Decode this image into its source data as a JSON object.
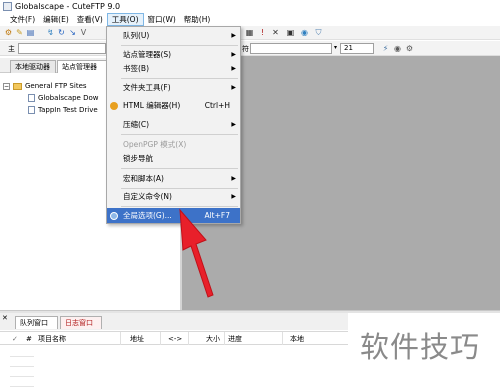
{
  "window": {
    "title": "Globalscape - CuteFTP 9.0"
  },
  "menubar": [
    {
      "label": "文件(F)"
    },
    {
      "label": "编辑(E)"
    },
    {
      "label": "查看(V)"
    },
    {
      "label": "工具(O)"
    },
    {
      "label": "窗口(W)"
    },
    {
      "label": "帮助(H)"
    }
  ],
  "quickconnect": {
    "host_label": "主",
    "password_label": "符",
    "port_value": "21"
  },
  "left_tabs": {
    "local": "本地驱动器",
    "site_manager": "站点管理器"
  },
  "tree": {
    "root": "General FTP Sites",
    "children": [
      "Globalscape Dow",
      "TappIn Test Drive"
    ]
  },
  "tools_menu": {
    "items": [
      {
        "label": "队列(U)",
        "shortcut": "",
        "submenu": true,
        "disabled": false
      },
      {
        "label": "站点管理器(S)",
        "shortcut": "",
        "submenu": true,
        "disabled": false
      },
      {
        "label": "书签(B)",
        "shortcut": "",
        "submenu": true,
        "disabled": false
      },
      {
        "label": "文件夹工具(F)",
        "shortcut": "",
        "submenu": true,
        "disabled": false
      },
      {
        "label": "HTML 编辑器(H)",
        "shortcut": "Ctrl+H",
        "submenu": false,
        "disabled": false
      },
      {
        "label": "压缩(C)",
        "shortcut": "",
        "submenu": true,
        "disabled": false
      },
      {
        "label": "OpenPGP 模式(X)",
        "shortcut": "",
        "submenu": false,
        "disabled": true
      },
      {
        "label": "锁步导航",
        "shortcut": "",
        "submenu": false,
        "disabled": false
      },
      {
        "label": "宏和脚本(A)",
        "shortcut": "",
        "submenu": true,
        "disabled": false
      },
      {
        "label": "自定义命令(N)",
        "shortcut": "",
        "submenu": true,
        "disabled": false
      },
      {
        "label": "全局选项(G)...",
        "shortcut": "Alt+F7",
        "submenu": false,
        "disabled": false
      }
    ]
  },
  "bottom_tabs": {
    "queue": "队列窗口",
    "log": "日志窗口"
  },
  "queue_columns": [
    "#",
    "项目名称",
    "地址",
    "<->",
    "大小",
    "进度",
    "本地"
  ],
  "watermark": "软件技巧",
  "colors": {
    "highlight": "#3d72c8",
    "arrow": "#e8202a",
    "panel_gray": "#ababab"
  }
}
